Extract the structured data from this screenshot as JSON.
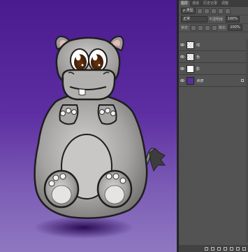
{
  "panel": {
    "tabs": [
      "图层",
      "通道",
      "历史记录",
      "调整"
    ],
    "filter_label": "ρ 类型",
    "blend_mode": "正常",
    "opacity_label": "不透明度:",
    "opacity_value": "100%",
    "lock_label": "锁定:",
    "fill_label": "填充:",
    "fill_value": "100%",
    "layers": [
      {
        "name": "线",
        "thumb": "checker",
        "visible": true
      },
      {
        "name": "色",
        "thumb": "checker",
        "visible": true
      },
      {
        "name": "影",
        "thumb": "line",
        "visible": true
      },
      {
        "name": "背景",
        "thumb": "bg",
        "visible": true,
        "locked": true
      }
    ]
  },
  "colors": {
    "canvas_top": "#4a1a8f",
    "canvas_bottom": "#8f78c1",
    "hippo_body": "#8c8c8c",
    "panel_bg": "#535353"
  }
}
